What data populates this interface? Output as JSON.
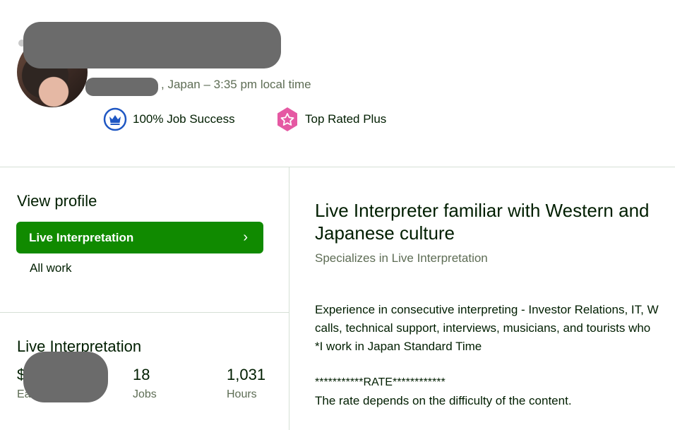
{
  "header": {
    "location": ", Japan – 3:35 pm local time",
    "badges": [
      {
        "icon": "crown-icon",
        "label": "100% Job Success",
        "color": "#1f57c3"
      },
      {
        "icon": "star-badge-icon",
        "label": "Top Rated Plus",
        "color": "#e559a3"
      }
    ]
  },
  "sidebar": {
    "view_profile": "View profile",
    "active_specialization": "Live Interpretation",
    "chevron": "›",
    "all_work": "All work"
  },
  "stats": {
    "title": "Live Interpretation",
    "earned_prefix": "$",
    "earned_label_prefix": "Ea",
    "jobs_value": "18",
    "jobs_label": "Jobs",
    "hours_value": "1,031",
    "hours_label": "Hours"
  },
  "main": {
    "title": "Live Interpreter familiar with Western and Japanese culture",
    "specializes": "Specializes in Live Interpretation",
    "description": [
      "Experience in consecutive interpreting - Investor Relations, IT, W",
      "calls, technical support, interviews, musicians, and tourists who",
      "*I work in Japan Standard Time"
    ],
    "rate_header": "***********RATE************",
    "rate_text": "The rate depends on the difficulty of the content."
  },
  "colors": {
    "accent": "#108a00",
    "text": "#001e00",
    "muted": "#5e6d55",
    "divider": "#d5e0d5"
  }
}
